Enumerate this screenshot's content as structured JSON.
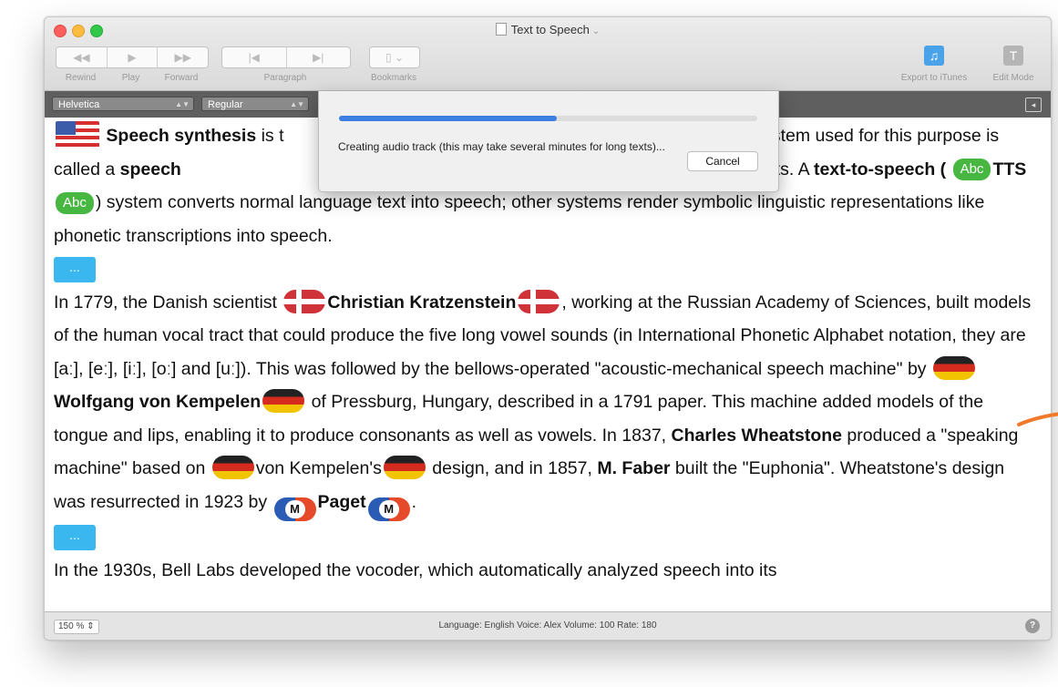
{
  "window": {
    "title": "Text to Speech"
  },
  "toolbar": {
    "rewind_label": "Rewind",
    "play_label": "Play",
    "forward_label": "Forward",
    "paragraph_label": "Paragraph",
    "bookmarks_label": "Bookmarks",
    "export_label": "Export to iTunes",
    "edit_mode_label": "Edit Mode"
  },
  "formatbar": {
    "font": "Helvetica",
    "style": "Regular"
  },
  "progress_dialog": {
    "progress": 0.52,
    "message": "Creating audio track (this may take several minutes for long texts)...",
    "cancel_label": "Cancel"
  },
  "document": {
    "p1": {
      "a": "Speech synthesis",
      "b": " is t",
      "c": "puter system used for this purpose is called a ",
      "d": "speech",
      "e": "re or hardware products. A ",
      "f": "text-to-speech (",
      "g": "Abc",
      "h": "TTS",
      "i": "Abc",
      "j": ") system converts normal language text into speech; other systems render symbolic linguistic representations like phonetic transcriptions into speech."
    },
    "more_label": "...",
    "p2": {
      "a": "In 1779, the Danish scientist ",
      "b": "Christian Kratzenstein",
      "c": ", working at the Russian Academy of Sciences, built models of the human vocal tract that could produce the five long vowel sounds (in International Phonetic Alphabet notation, they are [aː], [eː], [iː], [oː] and [uː]). This was followed by the bellows-operated \"acoustic-mechanical speech machine\" by ",
      "d": "Wolfgang von Kempelen",
      "e": " of Pressburg, Hungary, described in a 1791 paper. This machine added models of the tongue and lips, enabling it to produce consonants as well as vowels. In 1837, ",
      "f": "Charles Wheatstone",
      "g": " produced a \"speaking machine\" based on ",
      "h": "von Kempelen's",
      "i": " design, and in 1857, ",
      "j": "M. Faber",
      "k": " built the \"Euphonia\". Wheatstone's design was resurrected in 1923 by ",
      "l": "M",
      "m": "Paget",
      "n": "M",
      "o": "."
    },
    "p3": "In the 1930s, Bell Labs developed the vocoder, which automatically analyzed speech into its"
  },
  "statusbar": {
    "zoom": "150 % ",
    "status": "Language: English   Voice: Alex   Volume: 100   Rate: 180",
    "help": "?"
  },
  "colors": {
    "accent_blue": "#3d7fe0",
    "more_button": "#39b7ee",
    "badge_green": "#47b741",
    "annotation_orange": "#f07a2a"
  }
}
